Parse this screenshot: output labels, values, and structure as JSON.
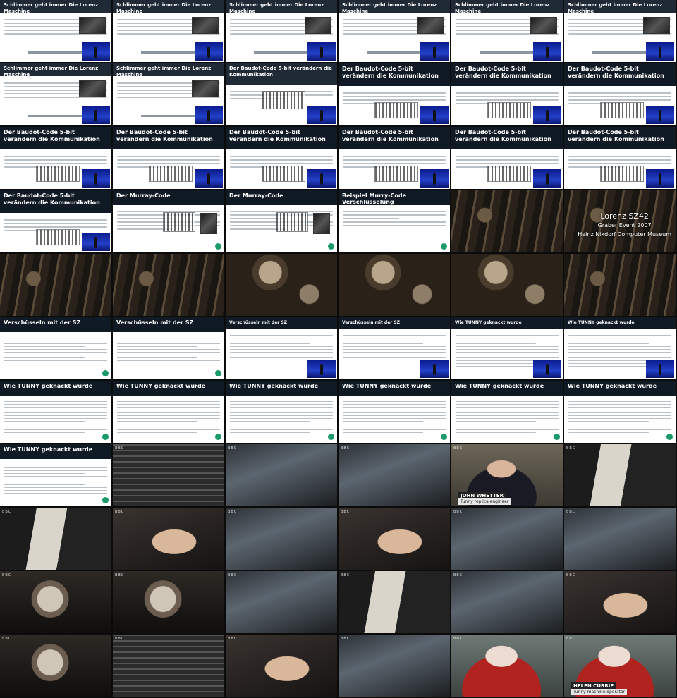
{
  "tiles": [
    {
      "kind": "slide-lorenz",
      "title": "Schlimmer geht immer Die Lorenz Maschine"
    },
    {
      "kind": "slide-lorenz",
      "title": "Schlimmer geht immer Die Lorenz Maschine"
    },
    {
      "kind": "slide-lorenz",
      "title": "Schlimmer geht immer Die Lorenz Maschine"
    },
    {
      "kind": "slide-lorenz",
      "title": "Schlimmer geht immer Die Lorenz Maschine"
    },
    {
      "kind": "slide-lorenz",
      "title": "Schlimmer geht immer Die Lorenz Maschine"
    },
    {
      "kind": "slide-lorenz",
      "title": "Schlimmer geht immer Die Lorenz Maschine"
    },
    {
      "kind": "slide-lorenz",
      "title": "Schlimmer geht immer Die Lorenz Maschine"
    },
    {
      "kind": "slide-lorenz",
      "title": "Schlimmer geht immer Die Lorenz Maschine"
    },
    {
      "kind": "slide-baudot-white",
      "title": "Der Baudot-Code 5-bit verändern die Kommunikation"
    },
    {
      "kind": "slide-baudot",
      "title": "Der Baudot-Code 5-bit verändern die Kommunikation"
    },
    {
      "kind": "slide-baudot",
      "title": "Der Baudot-Code 5-bit verändern die Kommunikation"
    },
    {
      "kind": "slide-baudot",
      "title": "Der Baudot-Code 5-bit verändern die Kommunikation"
    },
    {
      "kind": "slide-baudot",
      "title": "Der Baudot-Code 5-bit verändern die Kommunikation"
    },
    {
      "kind": "slide-baudot",
      "title": "Der Baudot-Code 5-bit verändern die Kommunikation"
    },
    {
      "kind": "slide-baudot",
      "title": "Der Baudot-Code 5-bit verändern die Kommunikation"
    },
    {
      "kind": "slide-baudot",
      "title": "Der Baudot-Code 5-bit verändern die Kommunikation"
    },
    {
      "kind": "slide-baudot",
      "title": "Der Baudot-Code 5-bit verändern die Kommunikation"
    },
    {
      "kind": "slide-baudot",
      "title": "Der Baudot-Code 5-bit verändern die Kommunikation"
    },
    {
      "kind": "slide-baudot",
      "title": "Der Baudot-Code 5-bit verändern die Kommunikation"
    },
    {
      "kind": "slide-murray",
      "title": "Der Murray-Code"
    },
    {
      "kind": "slide-murray",
      "title": "Der Murray-Code"
    },
    {
      "kind": "slide-murry",
      "title": "Beispiel Murry-Code Verschlüsselung"
    },
    {
      "kind": "photo-machine"
    },
    {
      "kind": "photo-machine-caption",
      "overlay": [
        "Lorenz SZ42",
        "Graber Event 2007",
        "Heinz Nixdorf Computer Museum"
      ]
    },
    {
      "kind": "photo-machine"
    },
    {
      "kind": "photo-machine"
    },
    {
      "kind": "photo-rotor"
    },
    {
      "kind": "photo-rotor"
    },
    {
      "kind": "photo-rotor"
    },
    {
      "kind": "photo-machine"
    },
    {
      "kind": "slide-sz",
      "title": "Verschüsseln mit der SZ"
    },
    {
      "kind": "slide-sz",
      "title": "Verschüsseln mit der SZ"
    },
    {
      "kind": "slide-sz-small",
      "title": "Verschüsseln mit der SZ"
    },
    {
      "kind": "slide-sz-small",
      "title": "Verschüsseln mit der SZ"
    },
    {
      "kind": "slide-tunny-small",
      "title": "Wie TUNNY geknackt wurde"
    },
    {
      "kind": "slide-tunny-small",
      "title": "Wie TUNNY geknackt wurde"
    },
    {
      "kind": "slide-tunny",
      "title": "Wie TUNNY geknackt wurde"
    },
    {
      "kind": "slide-tunny",
      "title": "Wie TUNNY geknackt wurde"
    },
    {
      "kind": "slide-tunny",
      "title": "Wie TUNNY geknackt wurde"
    },
    {
      "kind": "slide-tunny",
      "title": "Wie TUNNY geknackt wurde"
    },
    {
      "kind": "slide-tunny",
      "title": "Wie TUNNY geknackt wurde"
    },
    {
      "kind": "slide-tunny",
      "title": "Wie TUNNY geknackt wurde"
    },
    {
      "kind": "slide-tunny",
      "title": "Wie TUNNY geknackt wurde"
    },
    {
      "kind": "photo-panel"
    },
    {
      "kind": "photo-bbc"
    },
    {
      "kind": "photo-bbc"
    },
    {
      "kind": "photo-person",
      "name": "JOHN WHETTER",
      "role": "Tunny replica engineer"
    },
    {
      "kind": "photo-tape"
    },
    {
      "kind": "photo-tape"
    },
    {
      "kind": "photo-hand"
    },
    {
      "kind": "photo-bbc"
    },
    {
      "kind": "photo-hand"
    },
    {
      "kind": "photo-bbc"
    },
    {
      "kind": "photo-bbc"
    },
    {
      "kind": "photo-wheel"
    },
    {
      "kind": "photo-wheel"
    },
    {
      "kind": "photo-bbc"
    },
    {
      "kind": "photo-tape"
    },
    {
      "kind": "photo-bbc"
    },
    {
      "kind": "photo-hand"
    },
    {
      "kind": "photo-wheel"
    },
    {
      "kind": "photo-panel"
    },
    {
      "kind": "photo-hand"
    },
    {
      "kind": "photo-bbc"
    },
    {
      "kind": "photo-woman"
    },
    {
      "kind": "photo-woman",
      "name": "HELEN CURRIE",
      "role": "Tunny machine operator"
    }
  ],
  "bbc_mark": "BBC"
}
